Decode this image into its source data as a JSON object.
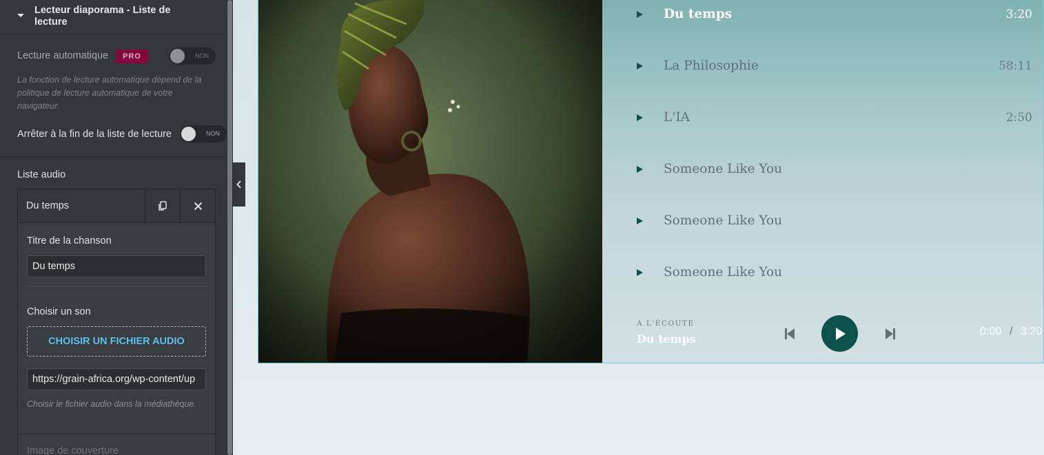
{
  "panel": {
    "section_title": "Lecteur diaporama - Liste de lecture",
    "autoplay": {
      "label": "Lecture automatique",
      "badge": "PRO",
      "state": "NON",
      "help": "La fonction de lecture automatique dépend de la politique de lecture automatique de votre navigateur."
    },
    "stop_at_end": {
      "label": "Arrêter à la fin de la liste de lecture",
      "state": "NON"
    },
    "audio_list_label": "Liste audio",
    "item": {
      "title": "Du temps",
      "song_title_label": "Titre de la chanson",
      "song_title_value": "Du temps",
      "choose_sound_label": "Choisir un son",
      "upload_button": "CHOISIR UN FICHIER AUDIO",
      "url_value": "https://grain-africa.org/wp-content/up",
      "help": "Choisir le fichier audio dans la médiathèque.",
      "cover_label": "Image de couverture"
    }
  },
  "player": {
    "tracks": [
      {
        "name": "Du temps",
        "duration": "3:20",
        "active": true
      },
      {
        "name": "La Philosophie",
        "duration": "58:11"
      },
      {
        "name": "L'IA",
        "duration": "2:50"
      },
      {
        "name": "Someone Like You",
        "duration": ""
      },
      {
        "name": "Someone Like You",
        "duration": ""
      },
      {
        "name": "Someone Like You",
        "duration": ""
      }
    ],
    "now_playing_label": "A L'ÉCOUTE",
    "now_playing_title": "Du temps",
    "current_time": "0:00",
    "time_separator": "/",
    "total_time": "3:20"
  },
  "colors": {
    "accent": "#0c514b",
    "pro_badge": "#93003f",
    "upload_link": "#5bc0eb"
  }
}
